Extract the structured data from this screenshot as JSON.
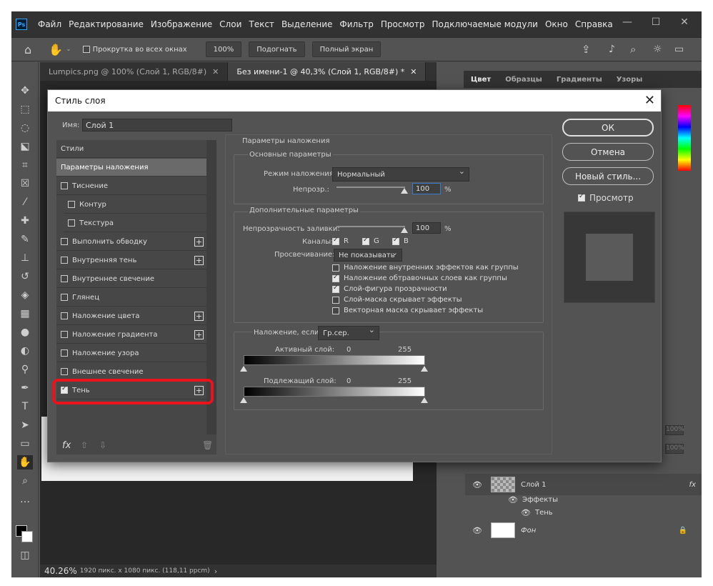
{
  "app": {
    "menu": [
      "Файл",
      "Редактирование",
      "Изображение",
      "Слои",
      "Текст",
      "Выделение",
      "Фильтр",
      "Просмотр",
      "Подключаемые модули",
      "Окно",
      "Справка"
    ],
    "logo": "Ps"
  },
  "options": {
    "scroll_all": "Прокрутка во всех окнах",
    "zoom": "100%",
    "fit": "Подогнать",
    "full": "Полный экран"
  },
  "tabs": [
    "Lumpics.png @ 100% (Слой 1, RGB/8#)",
    "Без имени-1 @ 40,3% (Слой 1, RGB/8#) *"
  ],
  "status": {
    "zoom": "40.26%",
    "info": "1920 пикс. x 1080 пикс. (118,11 ppcm)"
  },
  "panel_tabs": [
    "Цвет",
    "Образцы",
    "Градиенты",
    "Узоры"
  ],
  "layers": {
    "pct1": "100%",
    "pct2": "100%",
    "layer1": "Слой 1",
    "effects": "Эффекты",
    "shadow": "Тень",
    "bg": "Фон"
  },
  "dialog": {
    "title": "Стиль слоя",
    "name_label": "Имя:",
    "name_value": "Слой 1",
    "styles": [
      {
        "label": "Стили",
        "checkbox": false,
        "plus": false
      },
      {
        "label": "Параметры наложения",
        "checkbox": false,
        "plus": false,
        "selected": true
      },
      {
        "label": "Тиснение",
        "checkbox": true,
        "plus": false
      },
      {
        "label": "Контур",
        "checkbox": true,
        "plus": false,
        "indent": true
      },
      {
        "label": "Текстура",
        "checkbox": true,
        "plus": false,
        "indent": true
      },
      {
        "label": "Выполнить обводку",
        "checkbox": true,
        "plus": true
      },
      {
        "label": "Внутренняя тень",
        "checkbox": true,
        "plus": true
      },
      {
        "label": "Внутреннее свечение",
        "checkbox": true,
        "plus": false
      },
      {
        "label": "Глянец",
        "checkbox": true,
        "plus": false
      },
      {
        "label": "Наложение цвета",
        "checkbox": true,
        "plus": true
      },
      {
        "label": "Наложение градиента",
        "checkbox": true,
        "plus": true
      },
      {
        "label": "Наложение узора",
        "checkbox": true,
        "plus": false
      },
      {
        "label": "Внешнее свечение",
        "checkbox": true,
        "plus": false
      },
      {
        "label": "Тень",
        "checkbox": true,
        "checked": true,
        "plus": true
      }
    ],
    "blend_section": "Параметры наложения",
    "basic_section": "Основные параметры",
    "blend_mode_label": "Режим наложения:",
    "blend_mode_value": "Нормальный",
    "opacity_label": "Непрозр.:",
    "opacity_value": "100",
    "pct": "%",
    "advanced_section": "Дополнительные параметры",
    "fill_label": "Непрозрачность заливки:",
    "fill_value": "100",
    "channels_label": "Каналы:",
    "channels": [
      "R",
      "G",
      "B"
    ],
    "knockout_label": "Просвечивание:",
    "knockout_value": "Не показывать",
    "options": [
      {
        "label": "Наложение внутренних эффектов как группы",
        "checked": false
      },
      {
        "label": "Наложение обтравочных слоев как группы",
        "checked": true
      },
      {
        "label": "Слой-фигура прозрачности",
        "checked": true
      },
      {
        "label": "Слой-маска скрывает эффекты",
        "checked": false
      },
      {
        "label": "Векторная маска скрывает эффекты",
        "checked": false
      }
    ],
    "blend_if_label": "Наложение, если:",
    "blend_if_value": "Гр.сер.",
    "this_layer": "Активный слой:",
    "under_layer": "Подлежащий слой:",
    "min": "0",
    "max": "255",
    "ok": "ОК",
    "cancel": "Отмена",
    "new_style": "Новый стиль...",
    "preview": "Просмотр"
  }
}
